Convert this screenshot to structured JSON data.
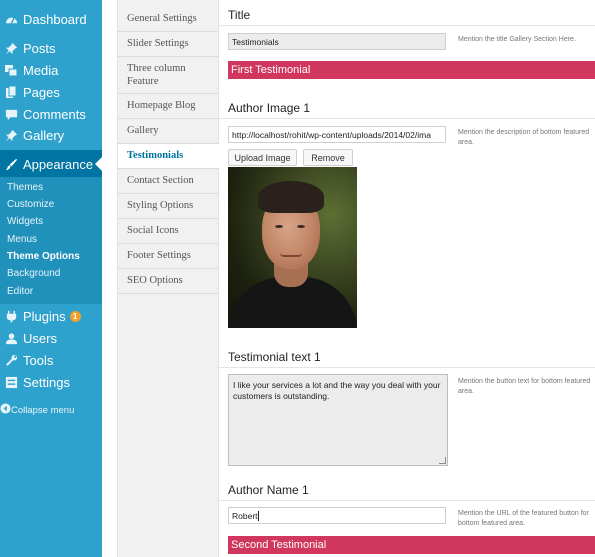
{
  "admin_menu": {
    "items": [
      {
        "label": "Dashboard",
        "icon": "dashboard-icon"
      },
      {
        "label": "Posts",
        "icon": "pushpin-icon"
      },
      {
        "label": "Media",
        "icon": "media-icon"
      },
      {
        "label": "Pages",
        "icon": "pages-icon"
      },
      {
        "label": "Comments",
        "icon": "comment-icon"
      },
      {
        "label": "Gallery",
        "icon": "pushpin-icon"
      },
      {
        "label": "Appearance",
        "icon": "paintbrush-icon"
      }
    ],
    "submenu": [
      "Themes",
      "Customize",
      "Widgets",
      "Menus",
      "Theme Options",
      "Background",
      "Editor"
    ],
    "lower_items": [
      {
        "label": "Plugins",
        "icon": "plugin-icon",
        "badge": "1"
      },
      {
        "label": "Users",
        "icon": "users-icon"
      },
      {
        "label": "Tools",
        "icon": "tools-icon"
      },
      {
        "label": "Settings",
        "icon": "settings-icon"
      }
    ],
    "collapse_label": "Collapse menu",
    "colors": {
      "sidebar": "#2ea2cc",
      "active": "#0074a2",
      "badge": "#f0a02b"
    }
  },
  "options_tabs": [
    "General Settings",
    "Slider Settings",
    "Three column Feature",
    "Homepage Blog",
    "Gallery",
    "Testimonials",
    "Contact Section",
    "Styling Options",
    "Social Icons",
    "Footer Settings",
    "SEO Options"
  ],
  "form": {
    "title_label": "Title",
    "title_value": "Testimonials",
    "title_help": "Mention the title Gallery Section Here.",
    "first_banner": "First Testimonial",
    "author_image_label": "Author Image 1",
    "author_image_url": "http://localhost/rohit/wp-content/uploads/2014/02/ima",
    "author_image_help": "Mention the description of bottom featured area.",
    "upload_button": "Upload Image",
    "remove_button": "Remove",
    "testimonial_text_label": "Testimonial text 1",
    "testimonial_text": "I like your services a lot and the way you deal with your customers is outstanding.",
    "testimonial_text_help": "Mention the button text for bottom featured area.",
    "author_name_label": "Author Name 1",
    "author_name_value": "Robert",
    "author_name_help": "Mention the URL of the featured button for bottom featured area.",
    "second_banner": "Second Testimonial",
    "banner_color": "#d1365f"
  }
}
